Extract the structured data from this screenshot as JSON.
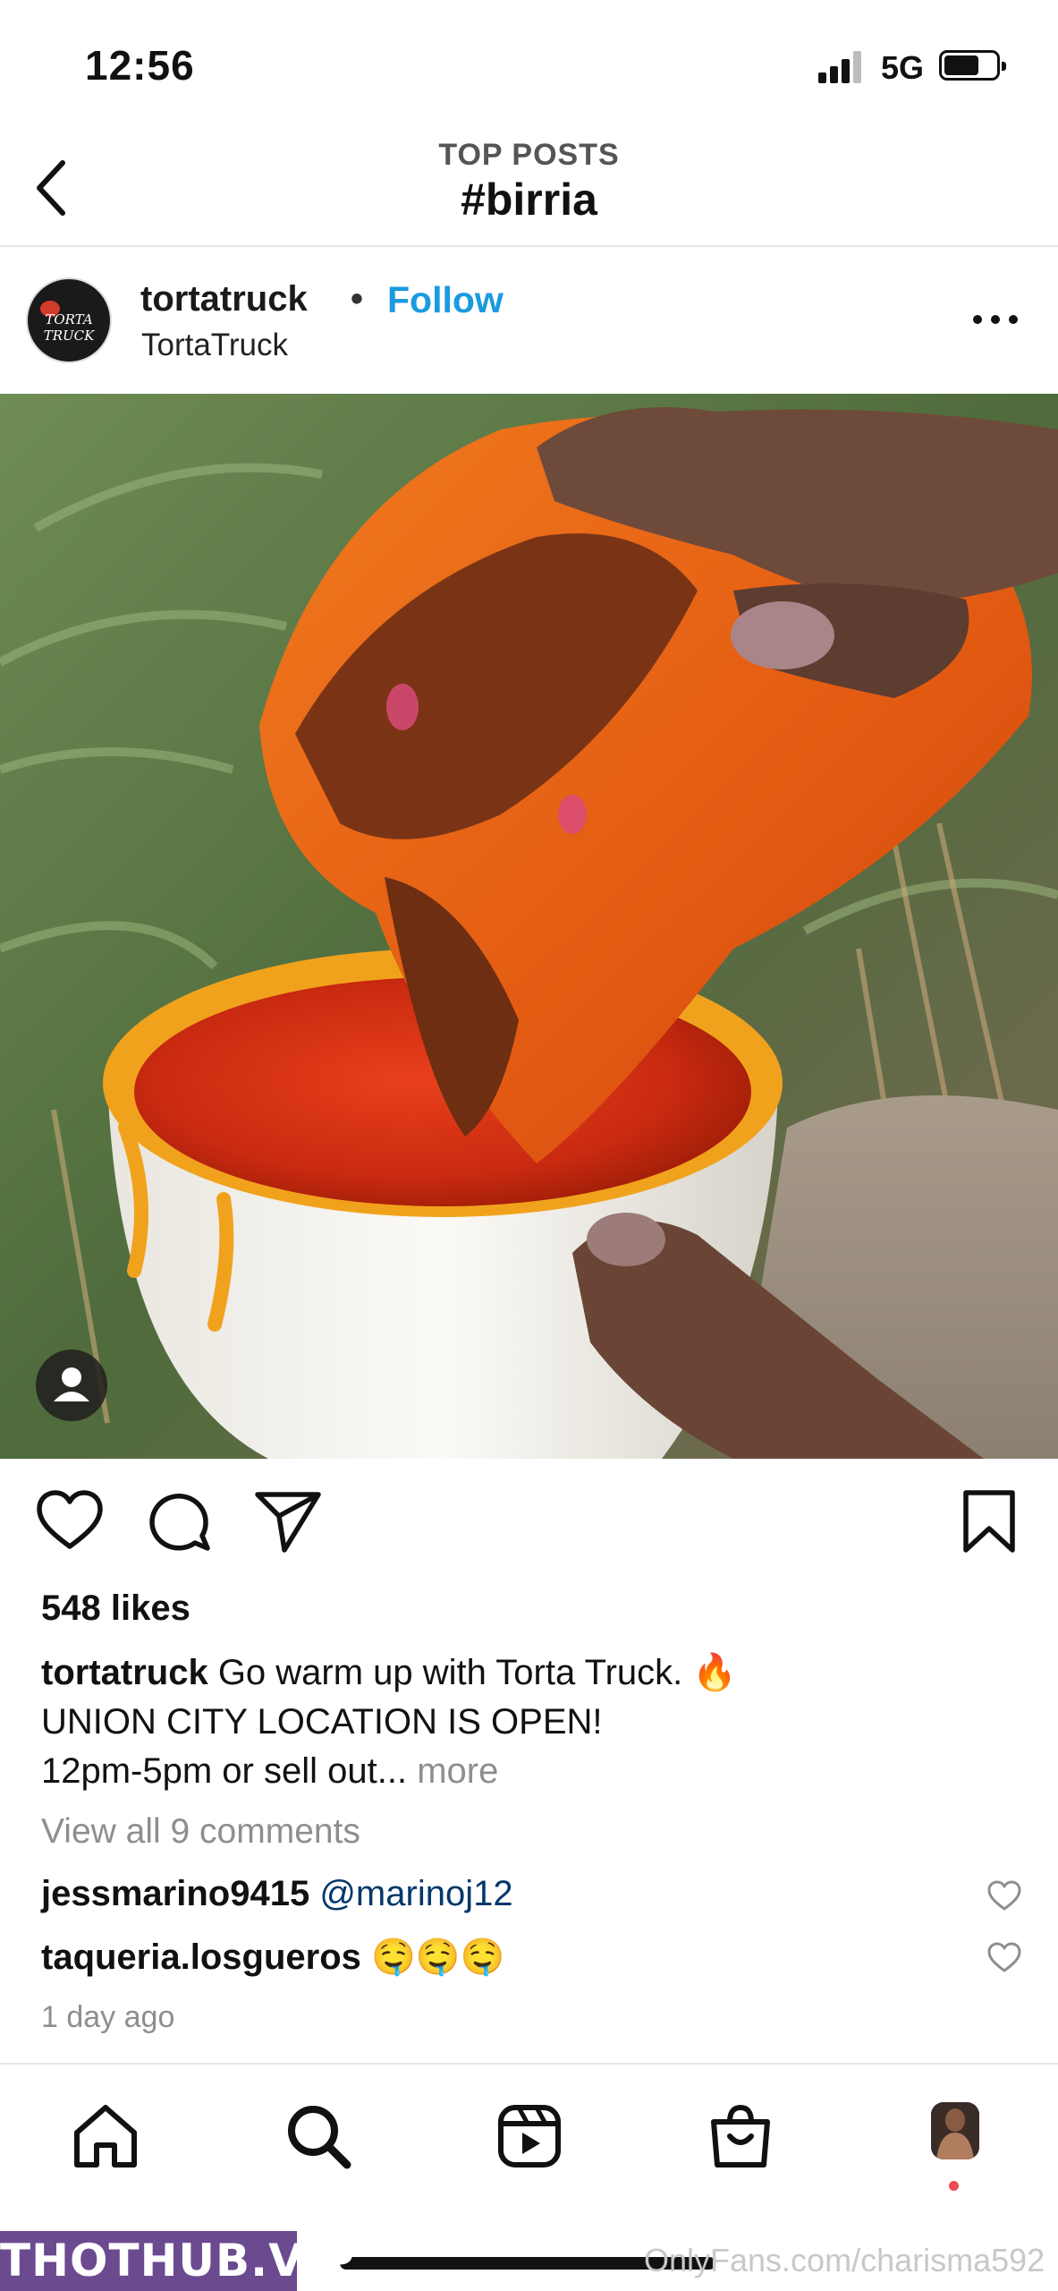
{
  "status_bar": {
    "time": "12:56",
    "network": "5G"
  },
  "header": {
    "subtitle": "TOP POSTS",
    "title": "#birria"
  },
  "post": {
    "username": "tortatruck",
    "separator": "•",
    "follow_label": "Follow",
    "sublabel": "TortaTruck",
    "avatar_text": "TORTA TRUCK",
    "likes": "548 likes",
    "caption": {
      "user": "tortatruck",
      "line1": " Go warm up with Torta Truck. 🔥",
      "line2": "UNION CITY LOCATION IS OPEN!",
      "line3": "12pm-5pm or sell out... ",
      "more": "more"
    },
    "view_comments": "View all 9 comments",
    "comments": [
      {
        "user": "jessmarino9415",
        "text": "@marinoj12"
      },
      {
        "user": "taqueria.losgueros",
        "text": "🤤🤤🤤"
      }
    ],
    "timestamp": "1 day ago"
  },
  "icons": {
    "back": "chevron-left-icon",
    "more": "more-horizontal-icon",
    "like": "heart-icon",
    "comment": "comment-bubble-icon",
    "share": "paper-plane-icon",
    "save": "bookmark-icon",
    "home": "home-icon",
    "search": "search-icon",
    "reels": "reels-icon",
    "shop": "shopping-bag-icon",
    "profile": "profile-avatar"
  },
  "colors": {
    "follow": "#1a9ae0",
    "mention": "#00376b",
    "muted": "#8e8e8e",
    "notification_dot": "#ed4956"
  },
  "watermarks": {
    "left": "THOTHUB.VIP",
    "right": "OnlyFans.com/charisma592"
  }
}
